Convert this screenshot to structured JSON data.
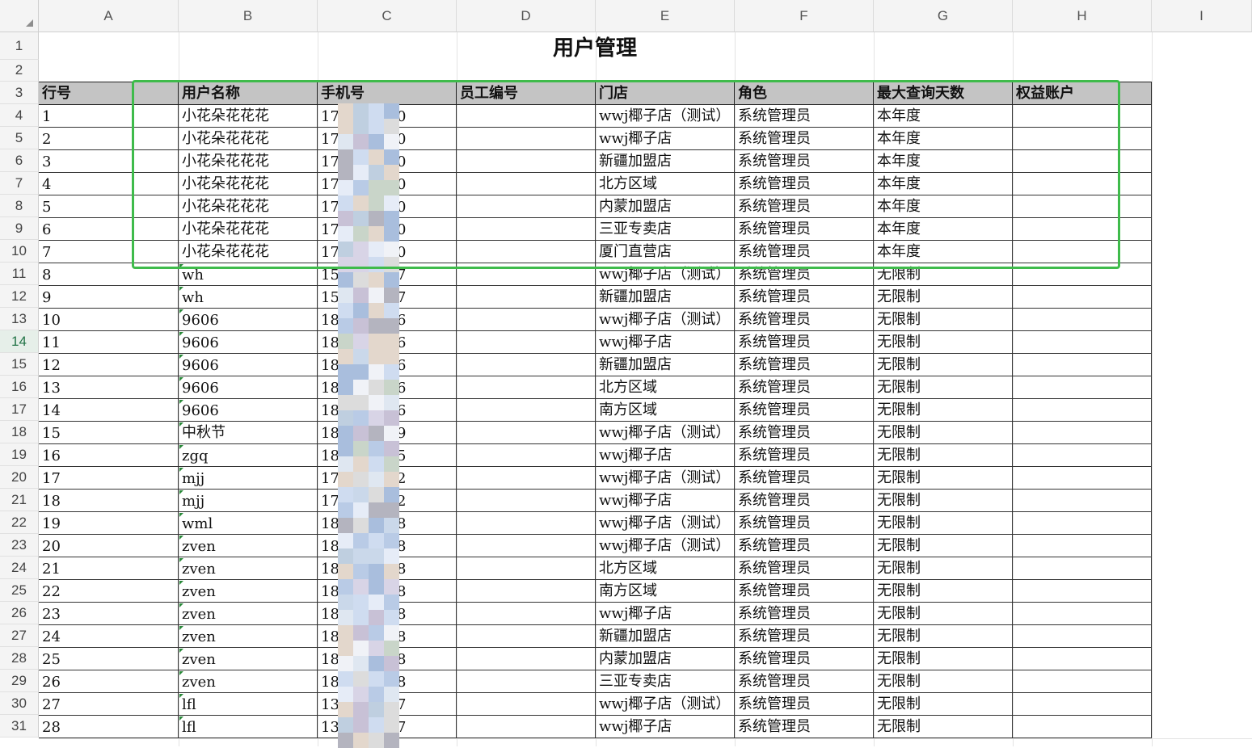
{
  "columns": [
    "A",
    "B",
    "C",
    "D",
    "E",
    "F",
    "G",
    "H",
    "I"
  ],
  "title": "用户管理",
  "headers": [
    "行号",
    "用户名称",
    "手机号",
    "员工编号",
    "门店",
    "角色",
    "最大查询天数",
    "权益账户"
  ],
  "rows": [
    {
      "no": "1",
      "name": "小花朵花花花",
      "phone_a": "17",
      "phone_b": "0",
      "store": "wwj椰子店（测试）",
      "role": "系统管理员",
      "days": "本年度"
    },
    {
      "no": "2",
      "name": "小花朵花花花",
      "phone_a": "17",
      "phone_b": "0",
      "store": "wwj椰子店",
      "role": "系统管理员",
      "days": "本年度"
    },
    {
      "no": "3",
      "name": "小花朵花花花",
      "phone_a": "17",
      "phone_b": "0",
      "store": "新疆加盟店",
      "role": "系统管理员",
      "days": "本年度"
    },
    {
      "no": "4",
      "name": "小花朵花花花",
      "phone_a": "17",
      "phone_b": "0",
      "store": "北方区域",
      "role": "系统管理员",
      "days": "本年度"
    },
    {
      "no": "5",
      "name": "小花朵花花花",
      "phone_a": "17",
      "phone_b": "0",
      "store": "内蒙加盟店",
      "role": "系统管理员",
      "days": "本年度"
    },
    {
      "no": "6",
      "name": "小花朵花花花",
      "phone_a": "17",
      "phone_b": "0",
      "store": "三亚专卖店",
      "role": "系统管理员",
      "days": "本年度"
    },
    {
      "no": "7",
      "name": "小花朵花花花",
      "phone_a": "17",
      "phone_b": "0",
      "store": "厦门直营店",
      "role": "系统管理员",
      "days": "本年度"
    },
    {
      "no": "8",
      "name": "wh",
      "phone_a": "15",
      "phone_b": "7",
      "store": "wwj椰子店（测试）",
      "role": "系统管理员",
      "days": "无限制"
    },
    {
      "no": "9",
      "name": "wh",
      "phone_a": "15",
      "phone_b": "7",
      "store": "新疆加盟店",
      "role": "系统管理员",
      "days": "无限制"
    },
    {
      "no": "10",
      "name": "9606",
      "phone_a": "18",
      "phone_b": "6",
      "store": "wwj椰子店（测试）",
      "role": "系统管理员",
      "days": "无限制"
    },
    {
      "no": "11",
      "name": "9606",
      "phone_a": "18",
      "phone_b": "6",
      "store": "wwj椰子店",
      "role": "系统管理员",
      "days": "无限制"
    },
    {
      "no": "12",
      "name": "9606",
      "phone_a": "18",
      "phone_b": "6",
      "store": "新疆加盟店",
      "role": "系统管理员",
      "days": "无限制"
    },
    {
      "no": "13",
      "name": "9606",
      "phone_a": "18",
      "phone_b": "6",
      "store": "北方区域",
      "role": "系统管理员",
      "days": "无限制"
    },
    {
      "no": "14",
      "name": "9606",
      "phone_a": "18",
      "phone_b": "6",
      "store": "南方区域",
      "role": "系统管理员",
      "days": "无限制"
    },
    {
      "no": "15",
      "name": "中秋节",
      "phone_a": "18",
      "phone_b": "9",
      "store": "wwj椰子店（测试）",
      "role": "系统管理员",
      "days": "无限制"
    },
    {
      "no": "16",
      "name": "zgq",
      "phone_a": "18",
      "phone_b": "5",
      "store": "wwj椰子店",
      "role": "系统管理员",
      "days": "无限制"
    },
    {
      "no": "17",
      "name": "mjj",
      "phone_a": "17",
      "phone_b": "2",
      "store": "wwj椰子店（测试）",
      "role": "系统管理员",
      "days": "无限制"
    },
    {
      "no": "18",
      "name": "mjj",
      "phone_a": "17",
      "phone_b": "2",
      "store": "wwj椰子店",
      "role": "系统管理员",
      "days": "无限制"
    },
    {
      "no": "19",
      "name": "wml",
      "phone_a": "18",
      "phone_b": "8",
      "store": "wwj椰子店（测试）",
      "role": "系统管理员",
      "days": "无限制"
    },
    {
      "no": "20",
      "name": "zven",
      "phone_a": "18",
      "phone_b": "8",
      "store": "wwj椰子店（测试）",
      "role": "系统管理员",
      "days": "无限制"
    },
    {
      "no": "21",
      "name": "zven",
      "phone_a": "18",
      "phone_b": "8",
      "store": "北方区域",
      "role": "系统管理员",
      "days": "无限制"
    },
    {
      "no": "22",
      "name": "zven",
      "phone_a": "18",
      "phone_b": "8",
      "store": "南方区域",
      "role": "系统管理员",
      "days": "无限制"
    },
    {
      "no": "23",
      "name": "zven",
      "phone_a": "18",
      "phone_b": "8",
      "store": "wwj椰子店",
      "role": "系统管理员",
      "days": "无限制"
    },
    {
      "no": "24",
      "name": "zven",
      "phone_a": "18",
      "phone_b": "8",
      "store": "新疆加盟店",
      "role": "系统管理员",
      "days": "无限制"
    },
    {
      "no": "25",
      "name": "zven",
      "phone_a": "18",
      "phone_b": "8",
      "store": "内蒙加盟店",
      "role": "系统管理员",
      "days": "无限制"
    },
    {
      "no": "26",
      "name": "zven",
      "phone_a": "18",
      "phone_b": "8",
      "store": "三亚专卖店",
      "role": "系统管理员",
      "days": "无限制"
    },
    {
      "no": "27",
      "name": "lfl",
      "phone_a": "13",
      "phone_b": "7",
      "store": "wwj椰子店（测试）",
      "role": "系统管理员",
      "days": "无限制"
    },
    {
      "no": "28",
      "name": "lfl",
      "phone_a": "13",
      "phone_b": "7",
      "store": "wwj椰子店",
      "role": "系统管理员",
      "days": "无限制"
    }
  ],
  "row_numbers": [
    "1",
    "2",
    "3",
    "4",
    "5",
    "6",
    "7",
    "8",
    "9",
    "10",
    "11",
    "12",
    "13",
    "14",
    "15",
    "16",
    "17",
    "18",
    "19",
    "20",
    "21",
    "22",
    "23",
    "24",
    "25",
    "26",
    "27",
    "28",
    "29",
    "30",
    "31"
  ],
  "active_row": "14",
  "colors": {
    "selection": "#3fbb4b",
    "header_fill": "#c4c4c4",
    "active_row": "#217346"
  }
}
